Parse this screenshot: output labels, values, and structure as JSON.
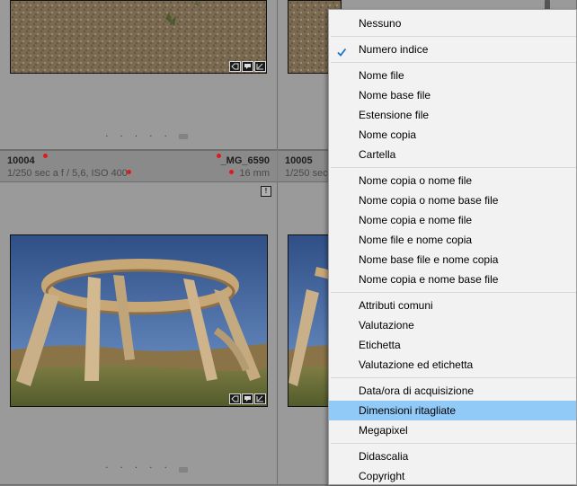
{
  "grid": {
    "cells": [
      {
        "id": "cell-top-left"
      },
      {
        "id": "cell-top-right"
      },
      {
        "id": "cell-main-left"
      },
      {
        "id": "cell-main-right"
      }
    ],
    "dots": ". . . . .",
    "photo_left": {
      "index": "10004",
      "filename": "_MG_6590",
      "exposure": "1/250 sec a f / 5,6, ISO 400",
      "focal": "16 mm",
      "warning": "!"
    },
    "photo_right": {
      "index": "10005",
      "exposure": "1/250 sec"
    }
  },
  "context_menu": {
    "groups": [
      [
        {
          "label": "Nessuno"
        }
      ],
      [
        {
          "label": "Numero indice",
          "checked": true
        }
      ],
      [
        {
          "label": "Nome file"
        },
        {
          "label": "Nome base file"
        },
        {
          "label": "Estensione file"
        },
        {
          "label": "Nome copia"
        },
        {
          "label": "Cartella"
        }
      ],
      [
        {
          "label": "Nome copia o nome file"
        },
        {
          "label": "Nome copia o nome base file"
        },
        {
          "label": "Nome copia e nome file"
        },
        {
          "label": "Nome file e nome copia"
        },
        {
          "label": "Nome base file e nome copia"
        },
        {
          "label": "Nome copia e nome base file"
        }
      ],
      [
        {
          "label": "Attributi comuni"
        },
        {
          "label": "Valutazione"
        },
        {
          "label": "Etichetta"
        },
        {
          "label": "Valutazione ed etichetta"
        }
      ],
      [
        {
          "label": "Data/ora di acquisizione"
        },
        {
          "label": "Dimensioni ritagliate",
          "highlighted": true
        },
        {
          "label": "Megapixel"
        }
      ],
      [
        {
          "label": "Didascalia"
        },
        {
          "label": "Copyright"
        }
      ]
    ]
  },
  "colors": {
    "highlight": "#91c9f7",
    "check": "#1a73c7",
    "flag_red": "#e01b1b"
  }
}
